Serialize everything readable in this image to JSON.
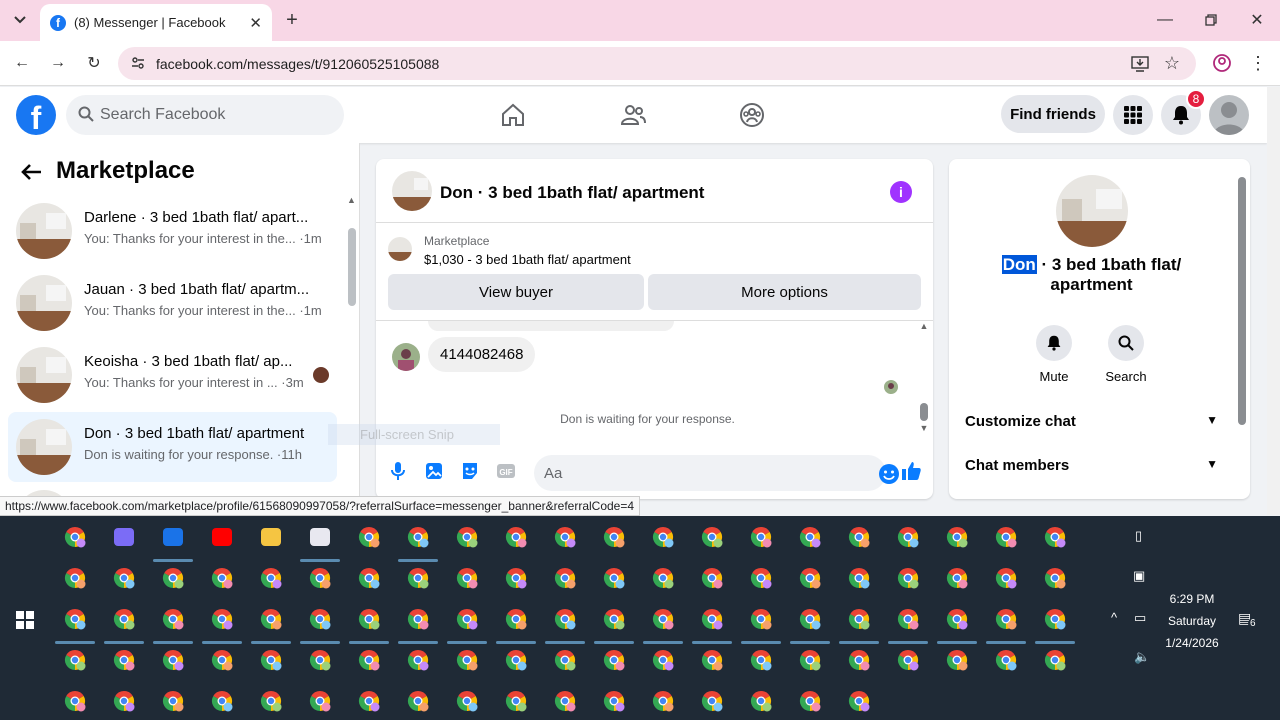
{
  "browser": {
    "tab_title": "(8) Messenger | Facebook",
    "tab_favicon": "f",
    "url": "facebook.com/messages/t/912060525105088",
    "status_url": "https://www.facebook.com/marketplace/profile/61568090997058/?referralSurface=messenger_banner&referralCode=4"
  },
  "header": {
    "search_placeholder": "Search Facebook",
    "find_friends": "Find friends",
    "notification_count": "8",
    "logo": "f"
  },
  "sidebar": {
    "title": "Marketplace",
    "conversations": [
      {
        "name": "Darlene · 3 bed 1bath flat/ apart...",
        "preview": "You: Thanks for your interest in the... ·1m"
      },
      {
        "name": "Jauan · 3 bed 1bath flat/ apartm...",
        "preview": "You: Thanks for your interest in the... ·1m"
      },
      {
        "name": "Keoisha · 3 bed 1bath flat/ ap...",
        "preview": "You: Thanks for your interest in ... ·3m"
      },
      {
        "name": "Don · 3 bed 1bath flat/ apartment",
        "preview": "Don is waiting for your response. ·11h"
      }
    ]
  },
  "chat": {
    "title": "Don · 3 bed 1bath flat/ apartment",
    "marketplace_label": "Marketplace",
    "listing": "$1,030 - 3 bed 1bath flat/ apartment",
    "view_buyer": "View buyer",
    "more_options": "More options",
    "message": "4144082468",
    "waiting": "Don is waiting for your response.",
    "composer_placeholder": "Aa"
  },
  "details": {
    "name_highlight": "Don",
    "name_rest": " · 3 bed 1bath flat/ apartment",
    "mute": "Mute",
    "search": "Search",
    "customize_chat": "Customize chat",
    "chat_members": "Chat members"
  },
  "ghost_text": "Full-screen Snip",
  "taskbar": {
    "time": "6:29 PM",
    "day": "Saturday",
    "date": "1/24/2026",
    "notif_count": "6"
  }
}
